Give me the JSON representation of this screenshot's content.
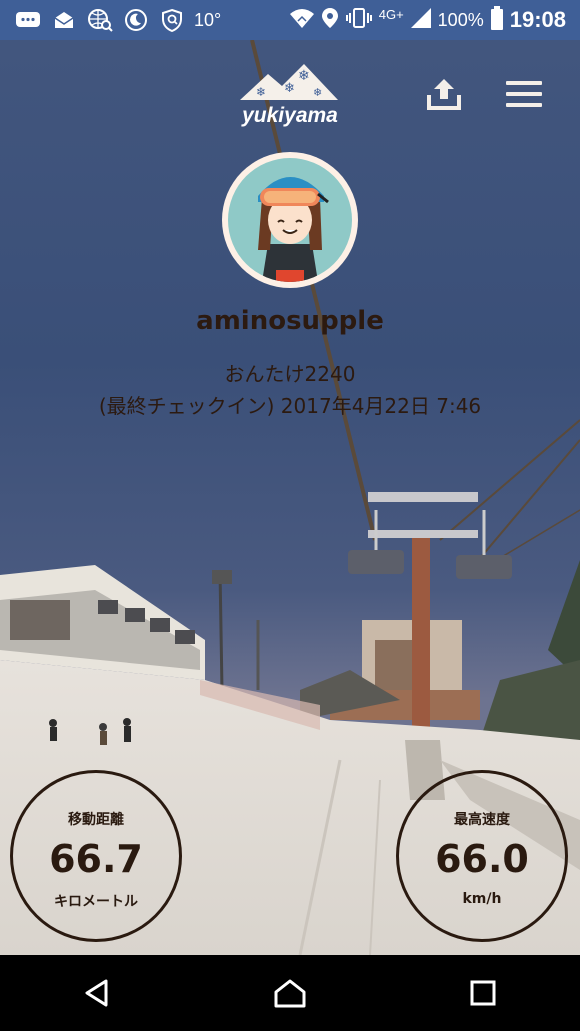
{
  "status_bar": {
    "temperature": "10°",
    "network": "4G+",
    "battery_percent": "100%",
    "time": "19:08",
    "icons": [
      "message-icon",
      "mail-icon",
      "globe-search-icon",
      "moon-icon",
      "shield-icon",
      "wifi-icon",
      "location-icon",
      "vibrate-icon",
      "signal-icon",
      "battery-icon"
    ]
  },
  "header": {
    "logo_text": "yukiyama",
    "share_icon": "share-upload-icon",
    "menu_icon": "hamburger-menu-icon"
  },
  "profile": {
    "username": "aminosupple",
    "location": "おんたけ2240",
    "last_checkin": "(最終チェックイン) 2017年4月22日 7:46"
  },
  "stats": {
    "distance": {
      "label": "移動距離",
      "value": "66.7",
      "unit": "キロメートル"
    },
    "max_speed": {
      "label": "最高速度",
      "value": "66.0",
      "unit": "km/h"
    }
  },
  "nav": {
    "icons": [
      "back-icon",
      "home-icon",
      "recents-icon"
    ]
  },
  "colors": {
    "status_bar": "#3f5f97",
    "text": "#2c1a10",
    "sky": "#3a5280",
    "snow": "#ece8e2"
  }
}
